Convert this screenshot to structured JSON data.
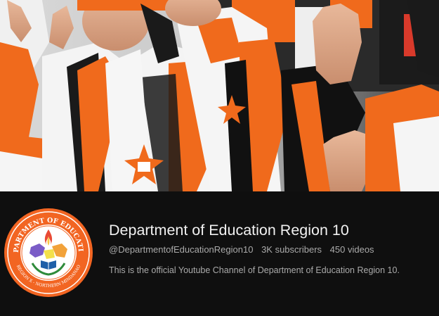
{
  "channel": {
    "name": "Department of Education Region 10",
    "handle": "@DepartmentofEducationRegion10",
    "subscribers": "3K subscribers",
    "videos": "450 videos",
    "description": "This is the official Youtube Channel of Department of Education Region 10."
  },
  "logo": {
    "top_text": "DEPARTMENT OF EDUCATION",
    "bottom_text": "REGION X - NORTHERN MINDANAO"
  },
  "colors": {
    "background": "#0f0f0f",
    "title": "#f1f1f1",
    "secondary_text": "#aaaaaa",
    "logo_orange": "#f26522",
    "jacket_orange": "#f06a1c"
  }
}
